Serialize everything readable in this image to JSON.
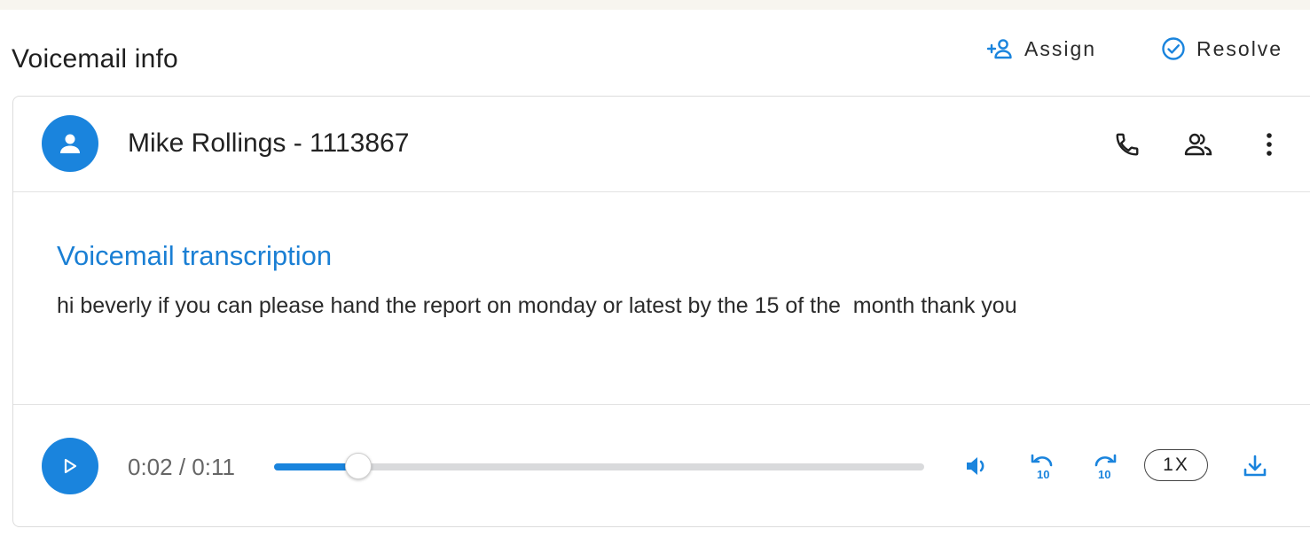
{
  "header": {
    "title": "Voicemail info",
    "assign_label": "Assign",
    "resolve_label": "Resolve"
  },
  "contact": {
    "name": "Mike Rollings - 1113867"
  },
  "transcription": {
    "title": "Voicemail transcription",
    "text": "hi beverly if you can please hand the report on monday or latest by the 15 of the  month thank you"
  },
  "player": {
    "time": "0:02 / 0:11",
    "progress_percent": 13,
    "speed": "1X"
  },
  "colors": {
    "accent": "#1a84dd",
    "text": "#222222"
  },
  "icons": [
    "add-person-icon",
    "check-circle-icon",
    "person-icon",
    "phone-icon",
    "contacts-icon",
    "more-vert-icon",
    "play-icon",
    "volume-icon",
    "rewind-10-icon",
    "forward-10-icon",
    "download-icon"
  ]
}
